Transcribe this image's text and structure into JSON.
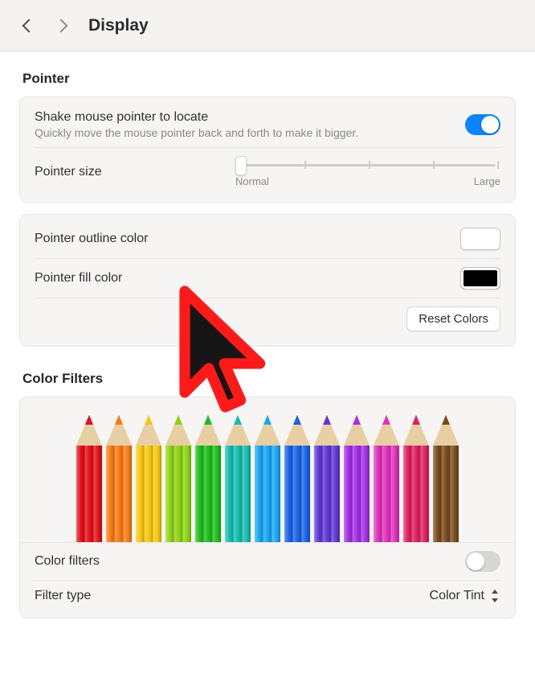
{
  "header": {
    "title": "Display"
  },
  "pointer": {
    "section_title": "Pointer",
    "shake_label": "Shake mouse pointer to locate",
    "shake_sub": "Quickly move the mouse pointer back and forth to make it bigger.",
    "shake_on": true,
    "size_label": "Pointer size",
    "size_min_label": "Normal",
    "size_max_label": "Large",
    "outline_label": "Pointer outline color",
    "outline_color": "#ffffff",
    "fill_label": "Pointer fill color",
    "fill_color": "#000000",
    "reset_label": "Reset Colors",
    "preview_cursor": {
      "outline": "#ff0000",
      "fill": "#161616"
    }
  },
  "color_filters": {
    "section_title": "Color Filters",
    "pencil_colors": [
      "#e40f18",
      "#f97b12",
      "#f8c70f",
      "#8ed313",
      "#1bbf1a",
      "#15bdb1",
      "#16a7f3",
      "#1863e6",
      "#6037d6",
      "#a230e7",
      "#e22fbd",
      "#e02060",
      "#7a4a1b"
    ],
    "toggle_label": "Color filters",
    "toggle_on": false,
    "filter_type_label": "Filter type",
    "filter_type_value": "Color Tint"
  }
}
